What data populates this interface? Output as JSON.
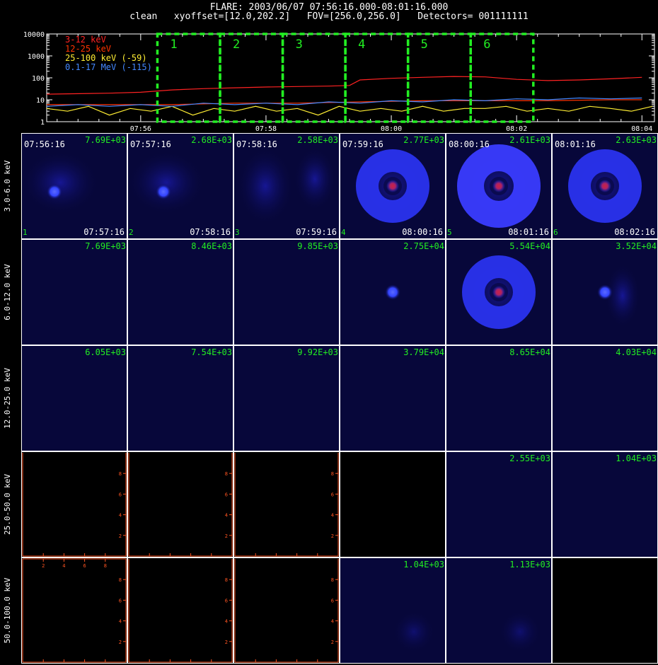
{
  "header": {
    "title": "FLARE: 2003/06/07 07:56:16.000-08:01:16.000",
    "subtitle": "clean   xyoffset=[12.0,202.2]   FOV=[256.0,256.0]   Detectors= 001111111"
  },
  "colors": {
    "background": "#000000",
    "axis": "#ffffff",
    "interval_box": "#22ee22",
    "count_label": "#22ee22",
    "empty_axis": "#ff5522",
    "band_3_12": "#ff2222",
    "band_12_25": "#ff3300",
    "band_25_100": "#ffee33",
    "band_100_17000": "#4488ff"
  },
  "chart_data": [
    {
      "type": "line",
      "id": "lightcurve",
      "title": "",
      "xlabel": "",
      "ylabel": "",
      "yscale": "log",
      "ylim": [
        1,
        10000
      ],
      "xlim": [
        "07:54:30",
        "08:04:12"
      ],
      "x_tick_labels": [
        "07:56",
        "07:58",
        "08:00",
        "08:02",
        "08:04"
      ],
      "y_tick_labels": [
        "1",
        "10",
        "100",
        "1000",
        "10000"
      ],
      "legend_position": "top-left",
      "series": [
        {
          "name": "3-12 keV",
          "color": "#ff2222",
          "x": [
            "07:54:30",
            "07:55:30",
            "07:56:00",
            "07:56:30",
            "07:57:00",
            "07:57:30",
            "07:58:00",
            "07:58:30",
            "07:59:00",
            "07:59:20",
            "07:59:30",
            "08:00:00",
            "08:00:30",
            "08:01:00",
            "08:01:30",
            "08:02:00",
            "08:02:30",
            "08:03:00",
            "08:03:30",
            "08:04:00"
          ],
          "y": [
            18,
            20,
            22,
            28,
            32,
            35,
            38,
            40,
            42,
            45,
            80,
            95,
            105,
            115,
            110,
            85,
            75,
            80,
            90,
            105
          ]
        },
        {
          "name": "12-25 keV",
          "color": "#ff3300",
          "x": [
            "07:54:30",
            "07:55:30",
            "07:56:30",
            "07:57:30",
            "07:58:30",
            "07:59:30",
            "08:00:30",
            "08:01:30",
            "08:02:30",
            "08:03:30",
            "08:04:00"
          ],
          "y": [
            6,
            6,
            6,
            7,
            7,
            8,
            9,
            9,
            9,
            10,
            10
          ]
        },
        {
          "name": "25-100 keV (-59)",
          "color": "#ffee33",
          "x": [
            "07:54:30",
            "07:54:50",
            "07:55:10",
            "07:55:30",
            "07:55:50",
            "07:56:10",
            "07:56:30",
            "07:56:50",
            "07:57:10",
            "07:57:30",
            "07:57:50",
            "07:58:10",
            "07:58:30",
            "07:58:50",
            "07:59:10",
            "07:59:30",
            "07:59:50",
            "08:00:10",
            "08:00:30",
            "08:00:50",
            "08:01:10",
            "08:01:30",
            "08:01:50",
            "08:02:10",
            "08:02:30",
            "08:02:50",
            "08:03:10",
            "08:03:30",
            "08:03:50",
            "08:04:10"
          ],
          "y": [
            4,
            3,
            5,
            2,
            4,
            3,
            5,
            2,
            4,
            3,
            5,
            3,
            4,
            2,
            5,
            3,
            4,
            3,
            5,
            3,
            4,
            4,
            5,
            3,
            4,
            3,
            5,
            4,
            3,
            5
          ]
        },
        {
          "name": "0.1-17 MeV (-115)",
          "color": "#4488ff",
          "x": [
            "07:54:30",
            "07:55:00",
            "07:55:30",
            "07:56:00",
            "07:56:30",
            "07:57:00",
            "07:57:30",
            "07:58:00",
            "07:58:30",
            "07:59:00",
            "07:59:30",
            "08:00:00",
            "08:00:30",
            "08:01:00",
            "08:01:30",
            "08:02:00",
            "08:02:30",
            "08:03:00",
            "08:03:30",
            "08:04:00"
          ],
          "y": [
            5,
            6,
            5,
            6,
            5,
            7,
            6,
            7,
            6,
            8,
            7,
            9,
            8,
            10,
            9,
            11,
            10,
            12,
            11,
            12
          ]
        }
      ],
      "intervals": [
        {
          "label": "1",
          "start": "07:56:16",
          "end": "07:57:16"
        },
        {
          "label": "2",
          "start": "07:57:16",
          "end": "07:58:16"
        },
        {
          "label": "3",
          "start": "07:58:16",
          "end": "07:59:16"
        },
        {
          "label": "4",
          "start": "07:59:16",
          "end": "08:00:16"
        },
        {
          "label": "5",
          "start": "08:00:16",
          "end": "08:01:16"
        },
        {
          "label": "6",
          "start": "08:01:16",
          "end": "08:02:16"
        }
      ]
    },
    {
      "type": "heatmap",
      "id": "image-grid",
      "energy_bands": [
        "3.0-6.0 keV",
        "6.0-12.0 keV",
        "12.0-25.0 keV",
        "25.0-50.0 keV",
        "50.0-100.0 keV"
      ],
      "time_start_labels": [
        "07:56:16",
        "07:57:16",
        "07:58:16",
        "07:59:16",
        "08:00:16",
        "08:01:16"
      ],
      "time_end_labels": [
        "07:57:16",
        "07:58:16",
        "07:59:16",
        "08:00:16",
        "08:01:16",
        "08:02:16"
      ],
      "interval_numbers": [
        "1",
        "2",
        "3",
        "4",
        "5",
        "6"
      ],
      "empty_axis_ticks": [
        "2",
        "4",
        "6",
        "8"
      ],
      "cells": [
        [
          {
            "max": "7.69E+03",
            "image": "faint_source"
          },
          {
            "max": "2.68E+03",
            "image": "faint_source"
          },
          {
            "max": "2.58E+03",
            "image": "faint_diffuse"
          },
          {
            "max": "2.77E+03",
            "image": "ring"
          },
          {
            "max": "2.61E+03",
            "image": "bright_ring"
          },
          {
            "max": "2.63E+03",
            "image": "ring"
          }
        ],
        [
          {
            "max": "7.69E+03",
            "image": "dark"
          },
          {
            "max": "8.46E+03",
            "image": "dark"
          },
          {
            "max": "9.85E+03",
            "image": "dark"
          },
          {
            "max": "2.75E+04",
            "image": "source"
          },
          {
            "max": "5.54E+04",
            "image": "ring"
          },
          {
            "max": "3.52E+04",
            "image": "source_faint_ring"
          }
        ],
        [
          {
            "max": "6.05E+03",
            "image": "dark"
          },
          {
            "max": "7.54E+03",
            "image": "dark"
          },
          {
            "max": "9.92E+03",
            "image": "dark"
          },
          {
            "max": "3.79E+04",
            "image": "dark"
          },
          {
            "max": "8.65E+04",
            "image": "dark"
          },
          {
            "max": "4.03E+04",
            "image": "dark"
          }
        ],
        [
          {
            "max": "",
            "image": "empty_axes"
          },
          {
            "max": "",
            "image": "empty_axes"
          },
          {
            "max": "",
            "image": "empty_axes"
          },
          {
            "max": "",
            "image": "black"
          },
          {
            "max": "2.55E+03",
            "image": "dark"
          },
          {
            "max": "1.04E+03",
            "image": "dark"
          }
        ],
        [
          {
            "max": "",
            "image": "empty_axes_with_top"
          },
          {
            "max": "",
            "image": "empty_axes"
          },
          {
            "max": "",
            "image": "empty_axes"
          },
          {
            "max": "1.04E+03",
            "image": "noise"
          },
          {
            "max": "1.13E+03",
            "image": "noise"
          },
          {
            "max": "",
            "image": "black"
          }
        ]
      ]
    }
  ]
}
